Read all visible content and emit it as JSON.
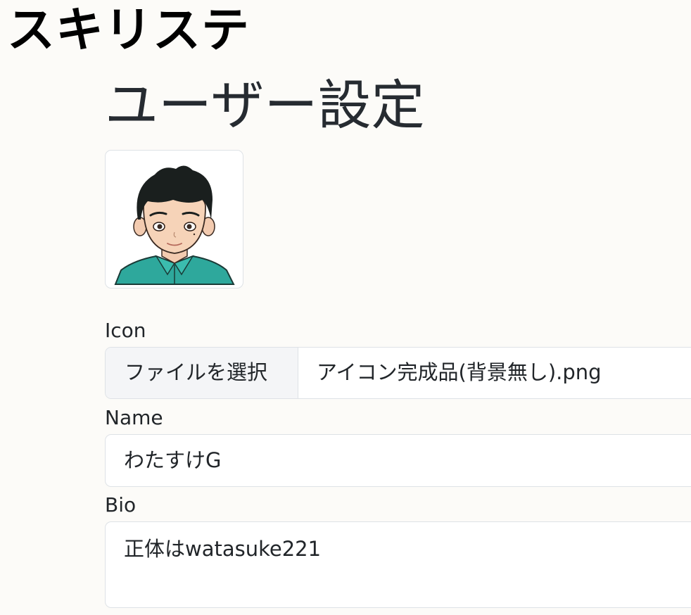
{
  "header": {
    "brand": "スキリステ"
  },
  "page": {
    "title": "ユーザー設定"
  },
  "avatar": {
    "icon": "user-avatar-illustration"
  },
  "form": {
    "icon": {
      "label": "Icon",
      "button_label": "ファイルを選択",
      "file_name": "アイコン完成品(背景無し).png"
    },
    "name": {
      "label": "Name",
      "value": "わたすけG"
    },
    "bio": {
      "label": "Bio",
      "value": "正体はwatasuke221"
    }
  },
  "colors": {
    "background": "#fcfbf8",
    "border": "#dee2e6",
    "shirt": "#2ea89c",
    "hair": "#1a1f1e"
  }
}
